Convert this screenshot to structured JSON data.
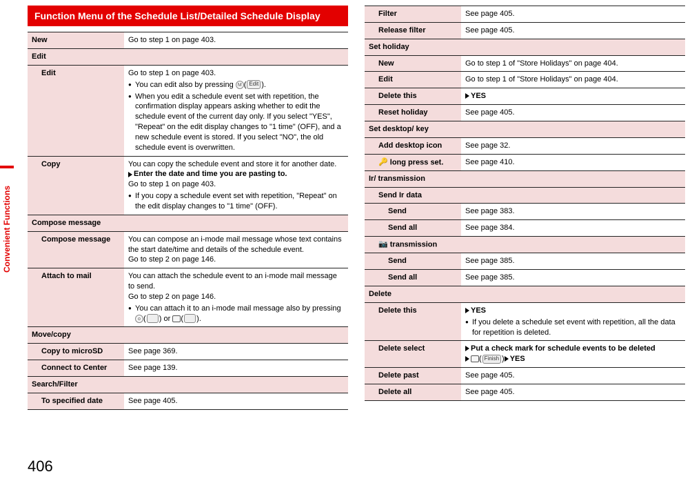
{
  "sideTab": "Convenient Functions",
  "pageNumber": "406",
  "sectionTitle": "Function Menu of the Schedule List/Detailed Schedule Display",
  "left": {
    "new": {
      "label": "New",
      "desc": "Go to step 1 on page 403."
    },
    "editGroup": "Edit",
    "edit": {
      "label": "Edit",
      "line1": "Go to step 1 on page 403.",
      "bullet1a": "You can edit also by pressing ",
      "bullet1key": "MENU",
      "bullet1soft": "Edit",
      "bullet1b": ".",
      "bullet2": "When you edit a schedule event set with repetition, the confirmation display appears asking whether to edit the schedule event of the current day only. If you select \"YES\", \"Repeat\" on the edit display changes to \"1 time\" (OFF), and a new schedule event is stored. If you select \"NO\", the old schedule event is overwritten."
    },
    "copy": {
      "label": "Copy",
      "line1": "You can copy the schedule event and store it for another date.",
      "tri1": "Enter the date and time you are pasting to.",
      "line2": "Go to step 1 on page 403.",
      "bullet1": "If you copy a schedule event set with repetition, \"Repeat\" on the edit display changes to \"1 time\" (OFF)."
    },
    "composeGroup": "Compose message",
    "compose": {
      "label": "Compose message",
      "desc": "You can compose an i-mode mail message whose text contains the start date/time and details of the schedule event.\nGo to step 2 on page 146."
    },
    "attach": {
      "label": "Attach to mail",
      "line1": "You can attach the schedule event to an i-mode mail message to send.",
      "line2": "Go to step 2 on page 146.",
      "bullet1a": "You can attach it to an i-mode mail message also by pressing ",
      "bullet1or": " or "
    },
    "moveGroup": "Move/copy",
    "microsd": {
      "label": "Copy to microSD",
      "desc": "See page 369."
    },
    "connect": {
      "label": "Connect to Center",
      "desc": "See page 139."
    },
    "searchGroup": "Search/Filter",
    "tospec": {
      "label": "To specified date",
      "desc": "See page 405."
    }
  },
  "right": {
    "filter": {
      "label": "Filter",
      "desc": "See page 405."
    },
    "release": {
      "label": "Release filter",
      "desc": "See page 405."
    },
    "holidayGroup": "Set holiday",
    "hnew": {
      "label": "New",
      "desc": "Go to step 1 of \"Store Holidays\" on page 404."
    },
    "hedit": {
      "label": "Edit",
      "desc": "Go to step 1 of \"Store Holidays\" on page 404."
    },
    "hdelete": {
      "label": "Delete this",
      "yes": "YES"
    },
    "hreset": {
      "label": "Reset holiday",
      "desc": "See page 405."
    },
    "desktopGroup": "Set desktop/      key",
    "adddesktop": {
      "label": "Add desktop icon",
      "desc": "See page 32."
    },
    "longpress": {
      "label": " long press set.",
      "desc": "See page 410."
    },
    "irGroup": "Ir/      transmission",
    "sendIrGroup": "Send Ir data",
    "irsend": {
      "label": "Send",
      "desc": "See page 383."
    },
    "irsendall": {
      "label": "Send all",
      "desc": "See page 384."
    },
    "icTransGroup": " transmission",
    "icsend": {
      "label": "Send",
      "desc": "See page 385."
    },
    "icsendall": {
      "label": "Send all",
      "desc": "See page 385."
    },
    "deleteGroup": "Delete",
    "dthis": {
      "label": "Delete this",
      "yes": "YES",
      "bullet": "If you delete a schedule set event with repetition, all the data for repetition is deleted."
    },
    "dselect": {
      "label": "Delete select",
      "tri1": "Put a check mark for schedule events to be deleted",
      "soft": "Finish",
      "yes": "YES"
    },
    "dpast": {
      "label": "Delete past",
      "desc": "See page 405."
    },
    "dall": {
      "label": "Delete all",
      "desc": "See page 405."
    }
  }
}
